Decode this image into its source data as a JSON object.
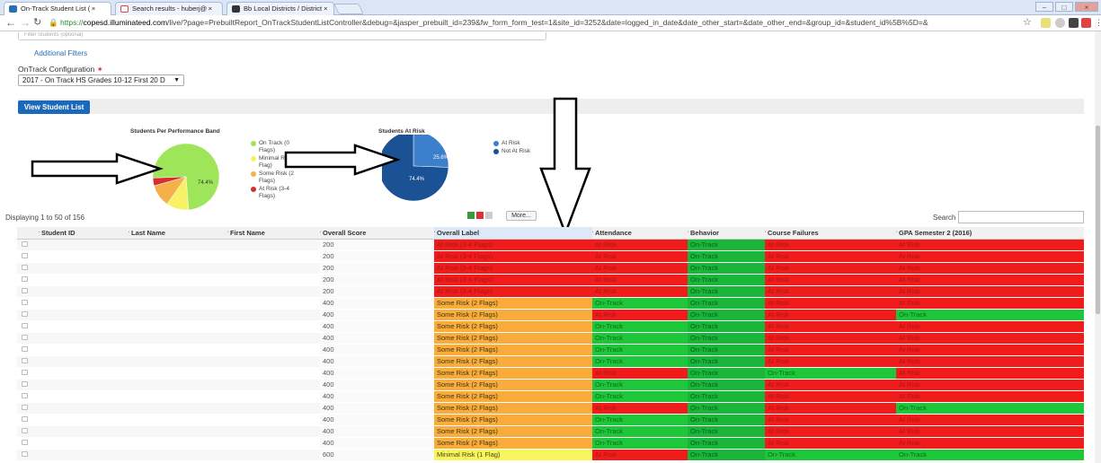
{
  "browser": {
    "tabs": [
      {
        "title": "On-Track Student List ( ×",
        "active": true
      },
      {
        "title": "Search results - huberj@ ×",
        "active": false
      },
      {
        "title": "Bb Local Districts / District ×",
        "active": false
      }
    ],
    "url_prefix": "https://",
    "url_host": "copesd.illuminateed.com",
    "url_rest": "/live/?page=PrebuiltReport_OnTrackStudentListController&debug=&jasper_prebuilt_id=239&fw_form_form_test=1&site_id=3252&date=logged_in_date&date_other_start=&date_other_end=&group_id=&student_id%5B%5D=&"
  },
  "filters": {
    "faded_label": "Filter Students (optional)",
    "additional_filters_link": "Additional Filters",
    "config_label": "OnTrack Configuration",
    "config_required_mark": "✶",
    "config_value": "2017 - On Track HS Grades 10-12 First 20 D"
  },
  "view_button": "View Student List",
  "charts": [
    {
      "id": "performance_band",
      "type": "pie",
      "title": "Students Per Performance Band",
      "slices": [
        {
          "label": "On Track (0 Flags)",
          "value": 74.4,
          "color": "#9ee55a"
        },
        {
          "label": "Minimal Risk (1 Flag)",
          "value": 10.9,
          "color": "#f7f167"
        },
        {
          "label": "Some Risk (2 Flags)",
          "value": 10.9,
          "color": "#f4b14a"
        },
        {
          "label": "At Risk (3-4 Flags)",
          "value": 3.8,
          "color": "#d32f2f"
        }
      ],
      "label_shown": "74.4%"
    },
    {
      "id": "at_risk",
      "type": "pie",
      "title": "Students At Risk",
      "slices": [
        {
          "label": "At Risk",
          "value": 25.6,
          "color": "#3c7fcd"
        },
        {
          "label": "Not At Risk",
          "value": 74.4,
          "color": "#1b5296"
        }
      ],
      "labels_shown": [
        "25.6%",
        "74.4%"
      ]
    }
  ],
  "chart_data": [
    {
      "type": "pie",
      "title": "Students Per Performance Band",
      "categories": [
        "On Track (0 Flags)",
        "Minimal Risk (1 Flag)",
        "Some Risk (2 Flags)",
        "At Risk (3-4 Flags)"
      ],
      "values": [
        74.4,
        10.9,
        10.9,
        3.8
      ]
    },
    {
      "type": "pie",
      "title": "Students At Risk",
      "categories": [
        "At Risk",
        "Not At Risk"
      ],
      "values": [
        25.6,
        74.4
      ]
    }
  ],
  "table_tools": {
    "displaying": "Displaying 1 to 50 of 156",
    "more_button": "More...",
    "search_label": "Search"
  },
  "table": {
    "headers": [
      "Student ID",
      "Last Name",
      "First Name",
      "Overall Score",
      "Overall Label",
      "Attendance",
      "Behavior",
      "Course Failures",
      "GPA Semester 2 (2016)"
    ],
    "rows": [
      [
        "200",
        "At Risk (3-4 Flags)",
        "At Risk",
        "On-Track",
        "At Risk",
        "At Risk"
      ],
      [
        "200",
        "At Risk (3-4 Flags)",
        "At Risk",
        "On-Track",
        "At Risk",
        "At Risk"
      ],
      [
        "200",
        "At Risk (3-4 Flags)",
        "At Risk",
        "On-Track",
        "At Risk",
        "At Risk"
      ],
      [
        "200",
        "At Risk (3-4 Flags)",
        "At Risk",
        "On-Track",
        "At Risk",
        "At Risk"
      ],
      [
        "200",
        "At Risk (3-4 Flags)",
        "At Risk",
        "On-Track",
        "At Risk",
        "At Risk"
      ],
      [
        "400",
        "Some Risk (2 Flags)",
        "On-Track",
        "On-Track",
        "At Risk",
        "At Risk"
      ],
      [
        "400",
        "Some Risk (2 Flags)",
        "At Risk",
        "On-Track",
        "At Risk",
        "On-Track"
      ],
      [
        "400",
        "Some Risk (2 Flags)",
        "On-Track",
        "On-Track",
        "At Risk",
        "At Risk"
      ],
      [
        "400",
        "Some Risk (2 Flags)",
        "On-Track",
        "On-Track",
        "At Risk",
        "At Risk"
      ],
      [
        "400",
        "Some Risk (2 Flags)",
        "On-Track",
        "On-Track",
        "At Risk",
        "At Risk"
      ],
      [
        "400",
        "Some Risk (2 Flags)",
        "On-Track",
        "On-Track",
        "At Risk",
        "At Risk"
      ],
      [
        "400",
        "Some Risk (2 Flags)",
        "At Risk",
        "On-Track",
        "On-Track",
        "At Risk"
      ],
      [
        "400",
        "Some Risk (2 Flags)",
        "On-Track",
        "On-Track",
        "At Risk",
        "At Risk"
      ],
      [
        "400",
        "Some Risk (2 Flags)",
        "On-Track",
        "On-Track",
        "At Risk",
        "At Risk"
      ],
      [
        "400",
        "Some Risk (2 Flags)",
        "At Risk",
        "On-Track",
        "At Risk",
        "On-Track"
      ],
      [
        "400",
        "Some Risk (2 Flags)",
        "On-Track",
        "On-Track",
        "At Risk",
        "At Risk"
      ],
      [
        "400",
        "Some Risk (2 Flags)",
        "On-Track",
        "On-Track",
        "At Risk",
        "At Risk"
      ],
      [
        "400",
        "Some Risk (2 Flags)",
        "On-Track",
        "On-Track",
        "At Risk",
        "At Risk"
      ],
      [
        "600",
        "Minimal Risk (1 Flag)",
        "At Risk",
        "On-Track",
        "On-Track",
        "On-Track"
      ]
    ]
  }
}
